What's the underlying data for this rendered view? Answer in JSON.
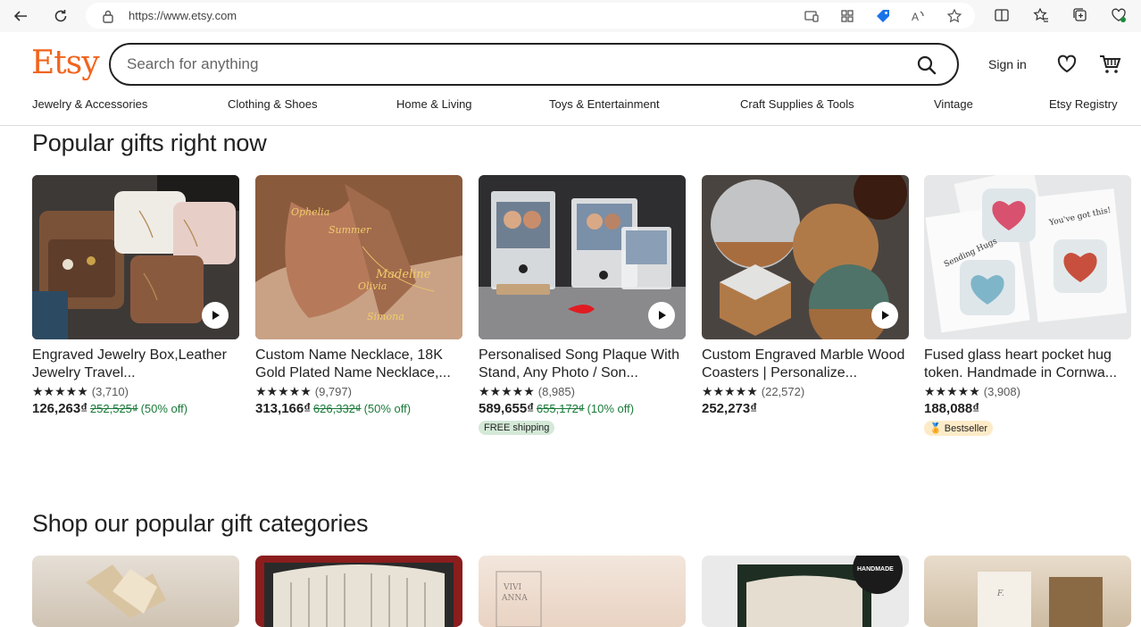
{
  "browser": {
    "url": "https://www.etsy.com"
  },
  "header": {
    "logo": "Etsy",
    "search_placeholder": "Search for anything",
    "sign_in": "Sign in",
    "brand_color": "#f1641e"
  },
  "categories": [
    "Jewelry & Accessories",
    "Clothing & Shoes",
    "Home & Living",
    "Toys & Entertainment",
    "Craft Supplies & Tools",
    "Vintage",
    "Etsy Registry"
  ],
  "popular_gifts": {
    "title": "Popular gifts right now",
    "items": [
      {
        "title": "Engraved Jewelry Box,Leather Jewelry Travel...",
        "stars": "★★★★★",
        "reviews": "(3,710)",
        "price": "126,263₫",
        "original_price": "252,525₫",
        "discount": "(50% off)",
        "badge": ""
      },
      {
        "title": "Custom Name Necklace, 18K Gold Plated Name Necklace,...",
        "stars": "★★★★★",
        "reviews": "(9,797)",
        "price": "313,166₫",
        "original_price": "626,332₫",
        "discount": "(50% off)",
        "badge": ""
      },
      {
        "title": "Personalised Song Plaque With Stand, Any Photo / Son...",
        "stars": "★★★★★",
        "reviews": "(8,985)",
        "price": "589,655₫",
        "original_price": "655,172₫",
        "discount": "(10% off)",
        "badge": "FREE shipping"
      },
      {
        "title": "Custom Engraved Marble Wood Coasters | Personalize...",
        "stars": "★★★★★",
        "reviews": "(22,572)",
        "price": "252,273₫",
        "original_price": "",
        "discount": "",
        "badge": ""
      },
      {
        "title": "Fused glass heart pocket hug token. Handmade in Cornwa...",
        "stars": "★★★★★",
        "reviews": "(3,908)",
        "price": "188,088₫",
        "original_price": "",
        "discount": "",
        "badge": "Bestseller"
      }
    ]
  },
  "gift_categories": {
    "title": "Shop our popular gift categories"
  }
}
